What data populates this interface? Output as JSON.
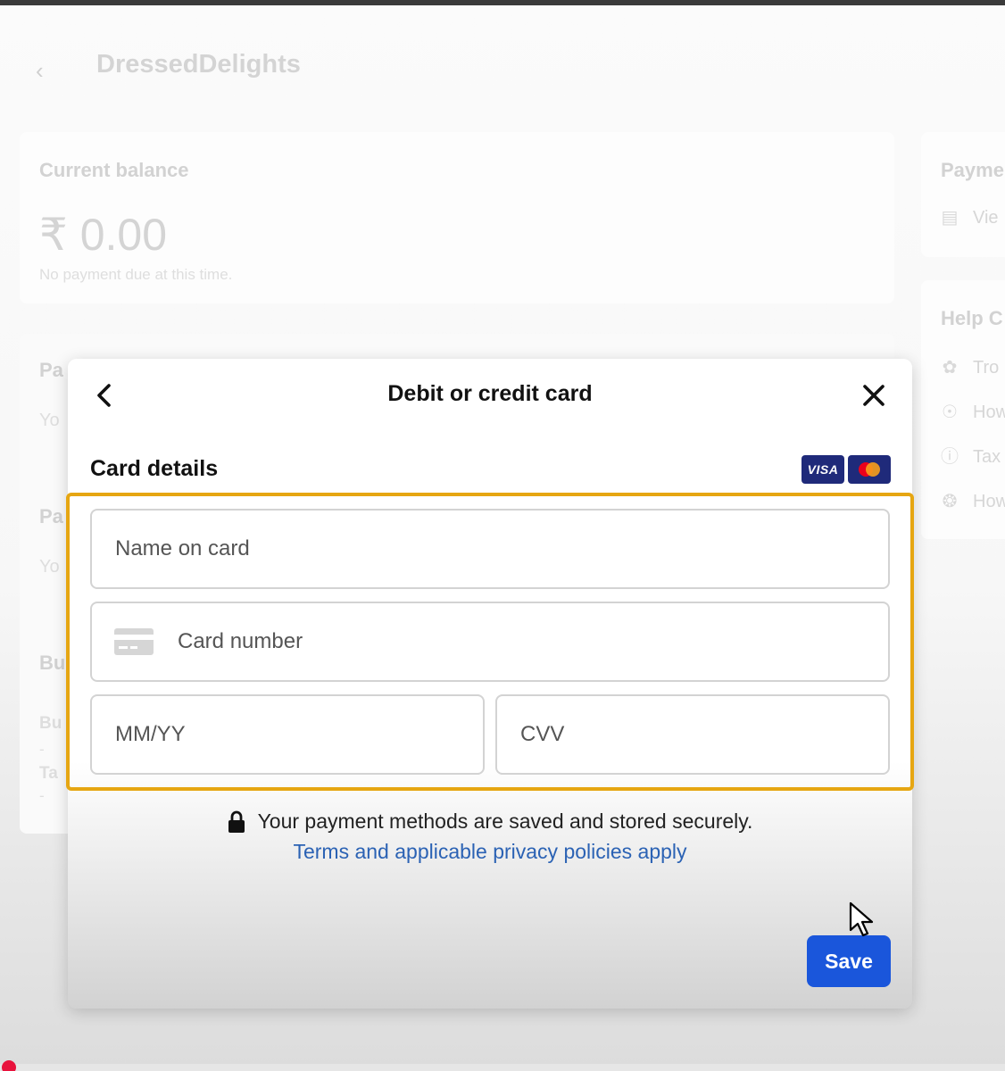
{
  "background": {
    "brand_name": "DressedDelights",
    "balance": {
      "label": "Current balance",
      "amount": "₹ 0.00",
      "note": "No payment due at this time."
    },
    "partial_labels": [
      "Pa",
      "Yo",
      "Pa",
      "Yo",
      "Bu",
      "Bu",
      "-",
      "Ta",
      "-"
    ],
    "side_panel": {
      "card1_title": "Payme",
      "card1_link": "Vie",
      "card2_title": "Help C",
      "card2_items": [
        "Tro",
        "How",
        "Tax",
        "How"
      ]
    }
  },
  "dialog": {
    "title": "Debit or credit card",
    "section_title": "Card details",
    "card_brands": [
      "VISA",
      "Mastercard"
    ],
    "colors": {
      "highlight": "#e6a612",
      "primary": "#1a56db",
      "link": "#2b62b4"
    },
    "fields": {
      "name_placeholder": "Name on card",
      "number_placeholder": "Card number",
      "expiry_placeholder": "MM/YY",
      "cvv_placeholder": "CVV"
    },
    "secure_note": "Your payment methods are saved and stored securely.",
    "terms_link": "Terms and applicable privacy policies apply",
    "save_label": "Save"
  }
}
